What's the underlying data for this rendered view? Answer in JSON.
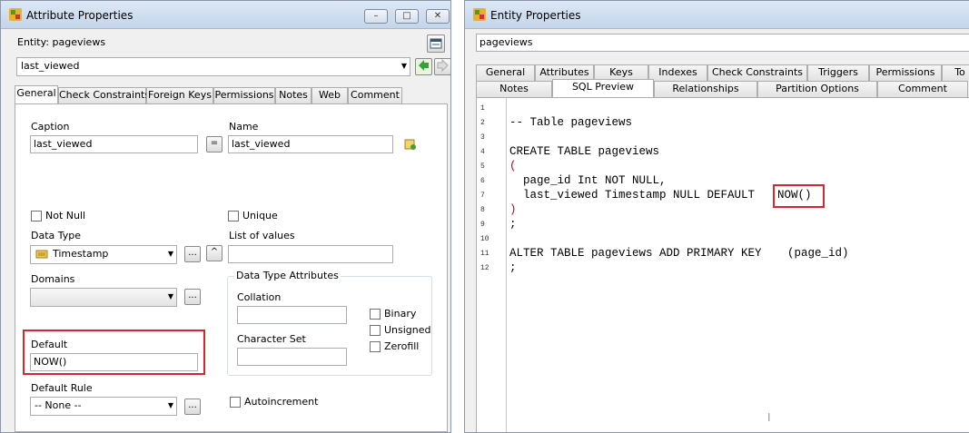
{
  "left": {
    "title": "Attribute Properties",
    "entity_label": "Entity: pageviews",
    "attribute_select": "last_viewed",
    "tabs": [
      "General",
      "Check Constraints",
      "Foreign Keys",
      "Permissions",
      "Notes",
      "Web",
      "Comment"
    ],
    "caption_label": "Caption",
    "caption_value": "last_viewed",
    "equals": "=",
    "name_label": "Name",
    "name_value": "last_viewed",
    "not_null": "Not Null",
    "unique": "Unique",
    "data_type_label": "Data Type",
    "data_type_value": "Timestamp",
    "list_of_values_label": "List of values",
    "domains_label": "Domains",
    "dta_title": "Data Type Attributes",
    "collation_label": "Collation",
    "charset_label": "Character Set",
    "binary": "Binary",
    "unsigned": "Unsigned",
    "zerofill": "Zerofill",
    "default_label": "Default",
    "default_value": "NOW()",
    "default_rule_label": "Default Rule",
    "default_rule_value": "-- None --",
    "autoincrement": "Autoincrement",
    "ellipsis": "...",
    "up_caret": "^"
  },
  "right": {
    "title": "Entity Properties",
    "entity_name": "pageviews",
    "tabs_row1": [
      "General",
      "Attributes",
      "Keys",
      "Indexes",
      "Check Constraints",
      "Triggers",
      "Permissions",
      "To"
    ],
    "tabs_row2": [
      "Notes",
      "SQL Preview",
      "Relationships",
      "Partition Options",
      "Comment"
    ],
    "line_numbers": [
      "1",
      "2",
      "3",
      "4",
      "5",
      "6",
      "7",
      "8",
      "9",
      "10",
      "11",
      "12"
    ],
    "code": {
      "l2": "-- Table pageviews",
      "l4": "CREATE TABLE pageviews",
      "l5": "(",
      "l6": "  page_id Int NOT NULL,",
      "l7a": "  last_viewed Timestamp NULL DEFAULT ",
      "l7b": "NOW()",
      "l8": ")",
      "l9": ";",
      "l11a": "ALTER TABLE pageviews ADD PRIMARY KEY ",
      "l11b": "(page_id)",
      "l12": ";"
    }
  },
  "colors": {
    "highlight": "#d9262c",
    "paren": "#c00000"
  }
}
